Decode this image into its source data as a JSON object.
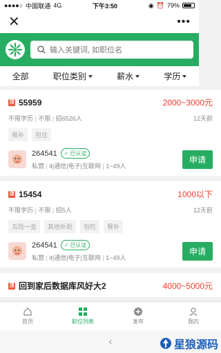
{
  "status": {
    "carrier": "中国联通",
    "network": "4G",
    "time": "下午3:50",
    "battery": "79%"
  },
  "search": {
    "placeholder": "输入关键词, 如职位名"
  },
  "filters": [
    {
      "label": "全部"
    },
    {
      "label": "职位类别"
    },
    {
      "label": "薪水"
    },
    {
      "label": "学历"
    }
  ],
  "jobs": [
    {
      "pin": "顶",
      "title": "55959",
      "salary": "2000~3000元",
      "meta": [
        "不限学历",
        "不限",
        "招6526人"
      ],
      "time": "12天前",
      "tags": [
        "餐补",
        "包住"
      ],
      "company": "264541",
      "verified": "已认证",
      "company_meta": [
        "私营",
        "it|通信|电子|互联网",
        "1~49人"
      ],
      "apply": "申请"
    },
    {
      "pin": "顶",
      "title": "15454",
      "salary": "1000以下",
      "meta": [
        "不限学历",
        "不限",
        "招5人"
      ],
      "time": "12天前",
      "tags": [
        "五险一金",
        "其他补助",
        "包吃",
        "餐补"
      ],
      "company": "264541",
      "verified": "已认证",
      "company_meta": [
        "私营",
        "it|通信|电子|互联网",
        "1~49人"
      ],
      "apply": "申请"
    },
    {
      "pin": "顶",
      "title": "回到家后数据库风好大2",
      "salary": "4000~5000元"
    }
  ],
  "tabs": [
    {
      "label": "首页"
    },
    {
      "label": "职位列表"
    },
    {
      "label": "发布"
    },
    {
      "label": "我的"
    }
  ],
  "watermark": "星狼源码",
  "colors": {
    "brand": "#27ad61",
    "salary": "#ee3b2b"
  }
}
